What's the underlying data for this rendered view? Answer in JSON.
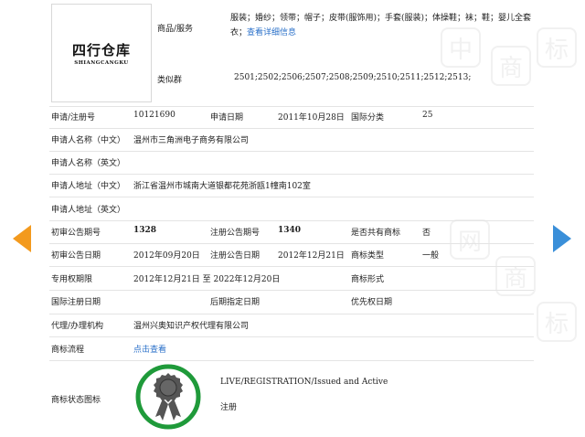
{
  "trademark": {
    "logo_text_cn": "四行仓库",
    "logo_text_en": "SHIANGCANGKU"
  },
  "goods": {
    "label": "商品/服务",
    "value": "服装；婚纱；领带；帽子；皮带(服饰用)；手套(服装)；体操鞋；袜；鞋；婴儿全套衣；",
    "more_link": "查看详细信息"
  },
  "similar_group": {
    "label": "类似群",
    "value": "2501;2502;2506;2507;2508;2509;2510;2511;2512;2513;"
  },
  "fields": {
    "reg_no_label": "申请/注册号",
    "reg_no": "10121690",
    "apply_date_label": "申请日期",
    "apply_date": "2011年10月28日",
    "intl_class_label": "国际分类",
    "intl_class": "25",
    "applicant_cn_label": "申请人名称（中文）",
    "applicant_cn": "温州市三角洲电子商务有限公司",
    "applicant_en_label": "申请人名称（英文）",
    "address_cn_label": "申请人地址（中文）",
    "address_cn": "浙江省温州市城南大道银都花苑浙瓯1幢南102室",
    "address_en_label": "申请人地址（英文）",
    "prelim_no_label": "初审公告期号",
    "prelim_no": "1328",
    "reg_pub_no_label": "注册公告期号",
    "reg_pub_no": "1340",
    "shared_label": "是否共有商标",
    "shared": "否",
    "prelim_date_label": "初审公告日期",
    "prelim_date": "2012年09月20日",
    "reg_pub_date_label": "注册公告日期",
    "reg_pub_date": "2012年12月21日",
    "tm_type_label": "商标类型",
    "tm_type": "一般",
    "exclusive_label": "专用权期限",
    "exclusive": "2012年12月21日 至 2022年12月20日",
    "tm_form_label": "商标形式",
    "intl_reg_date_label": "国际注册日期",
    "later_date_label": "后期指定日期",
    "priority_date_label": "优先权日期",
    "agent_label": "代理/办理机构",
    "agent": "温州兴奥知识产权代理有限公司",
    "process_label": "商标流程",
    "process_link": "点击查看",
    "status_icon_label": "商标状态图标",
    "status_en": "LIVE/REGISTRATION/Issued and Active",
    "status_cn": "注册"
  },
  "watermark": [
    "中",
    "商",
    "标",
    "网"
  ],
  "colors": {
    "link": "#2a70c9",
    "arrow_left": "#f39a1e",
    "arrow_right": "#3a8fd9",
    "badge_ring": "#1f9a3a"
  }
}
